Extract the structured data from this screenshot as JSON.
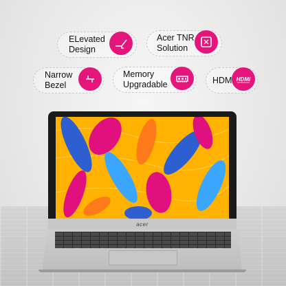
{
  "features": [
    {
      "id": "elevated-design",
      "label": "ELevated\nDesign",
      "icon": "elevated-hinge-icon"
    },
    {
      "id": "acer-tnr",
      "label": "Acer TNR\nSolution",
      "icon": "noise-reduction-icon"
    },
    {
      "id": "narrow-bezel",
      "label": "Narrow\nBezel",
      "icon": "narrow-bezel-icon"
    },
    {
      "id": "memory",
      "label": "Memory\nUpgradable",
      "icon": "ram-chip-icon"
    },
    {
      "id": "hdmi",
      "label": "HDMI",
      "icon": "hdmi-icon"
    }
  ],
  "laptop": {
    "brand": "acer"
  },
  "colors": {
    "accent": "#e6157c",
    "screen_bg": "#ffb300"
  }
}
